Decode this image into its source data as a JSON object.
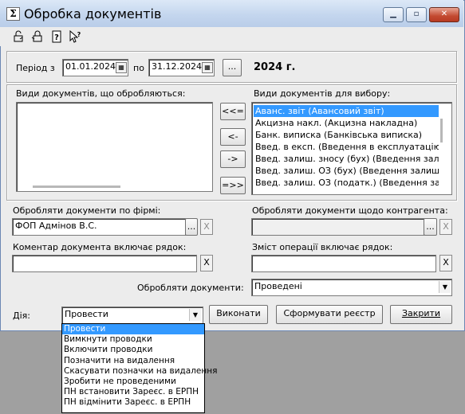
{
  "window": {
    "title": "Обробка документів",
    "caption_buttons": [
      "minimize",
      "maximize",
      "close"
    ]
  },
  "toolbar": {
    "icons": [
      "lock-open-icon",
      "lock-closed-icon",
      "help-icon",
      "pointer-help-icon"
    ]
  },
  "period": {
    "label_from": "Період з",
    "date_from": "01.01.2024",
    "label_to": "по",
    "date_to": "31.12.2024",
    "browse_label": "...",
    "year_text": "2024 г."
  },
  "processed_list": {
    "label": "Види документів, що обробляються:",
    "items": []
  },
  "move_buttons": {
    "add_all": "<<=",
    "add_one": "<-",
    "remove_one": "->",
    "remove_all": "=>>"
  },
  "choice_list": {
    "label": "Види документів для вибору:",
    "items": [
      "Аванс. звіт (Авансовий звіт)",
      "Акцизна накл. (Акцизна накладна)",
      "Банк. виписка (Банківська виписка)",
      "Введ. в експ. (Введення в експлуатацію)",
      "Введ. залиш. зносу (бух) (Введення залишк",
      "Введ. залиш. ОЗ (бух) (Введення залишків О",
      "Введ. залиш. ОЗ (податк.) (Введення залиш"
    ],
    "selected_index": 0
  },
  "firm": {
    "label": "Обробляти документи по фірмі:",
    "value": "ФОП Адмінов В.С.",
    "browse_label": "...",
    "clear_label": "X"
  },
  "counterparty": {
    "label": "Обробляти документи щодо контрагента:",
    "value": "",
    "browse_label": "...",
    "clear_label": "X"
  },
  "comment": {
    "label": "Коментар документа включає рядок:",
    "value": "",
    "clear_label": "X"
  },
  "operation": {
    "label": "Зміст операції включає рядок:",
    "value": "",
    "clear_label": "X"
  },
  "process_docs": {
    "label": "Обробляти документи:",
    "value": "Проведені"
  },
  "action": {
    "label": "Дія:",
    "value": "Провести",
    "options": [
      "Провести",
      "Вимкнути проводки",
      "Включити проводки",
      "Позначити на видалення",
      "Скасувати позначки на видалення",
      "Зробити не проведеними",
      "ПН встановити Зареєс. в ЕРПН",
      "ПН відмінити Зареєс. в ЕРПН"
    ],
    "selected_index": 0
  },
  "buttons": {
    "execute": "Виконати",
    "registry": "Сформувати реєстр",
    "close": "Закрити"
  }
}
